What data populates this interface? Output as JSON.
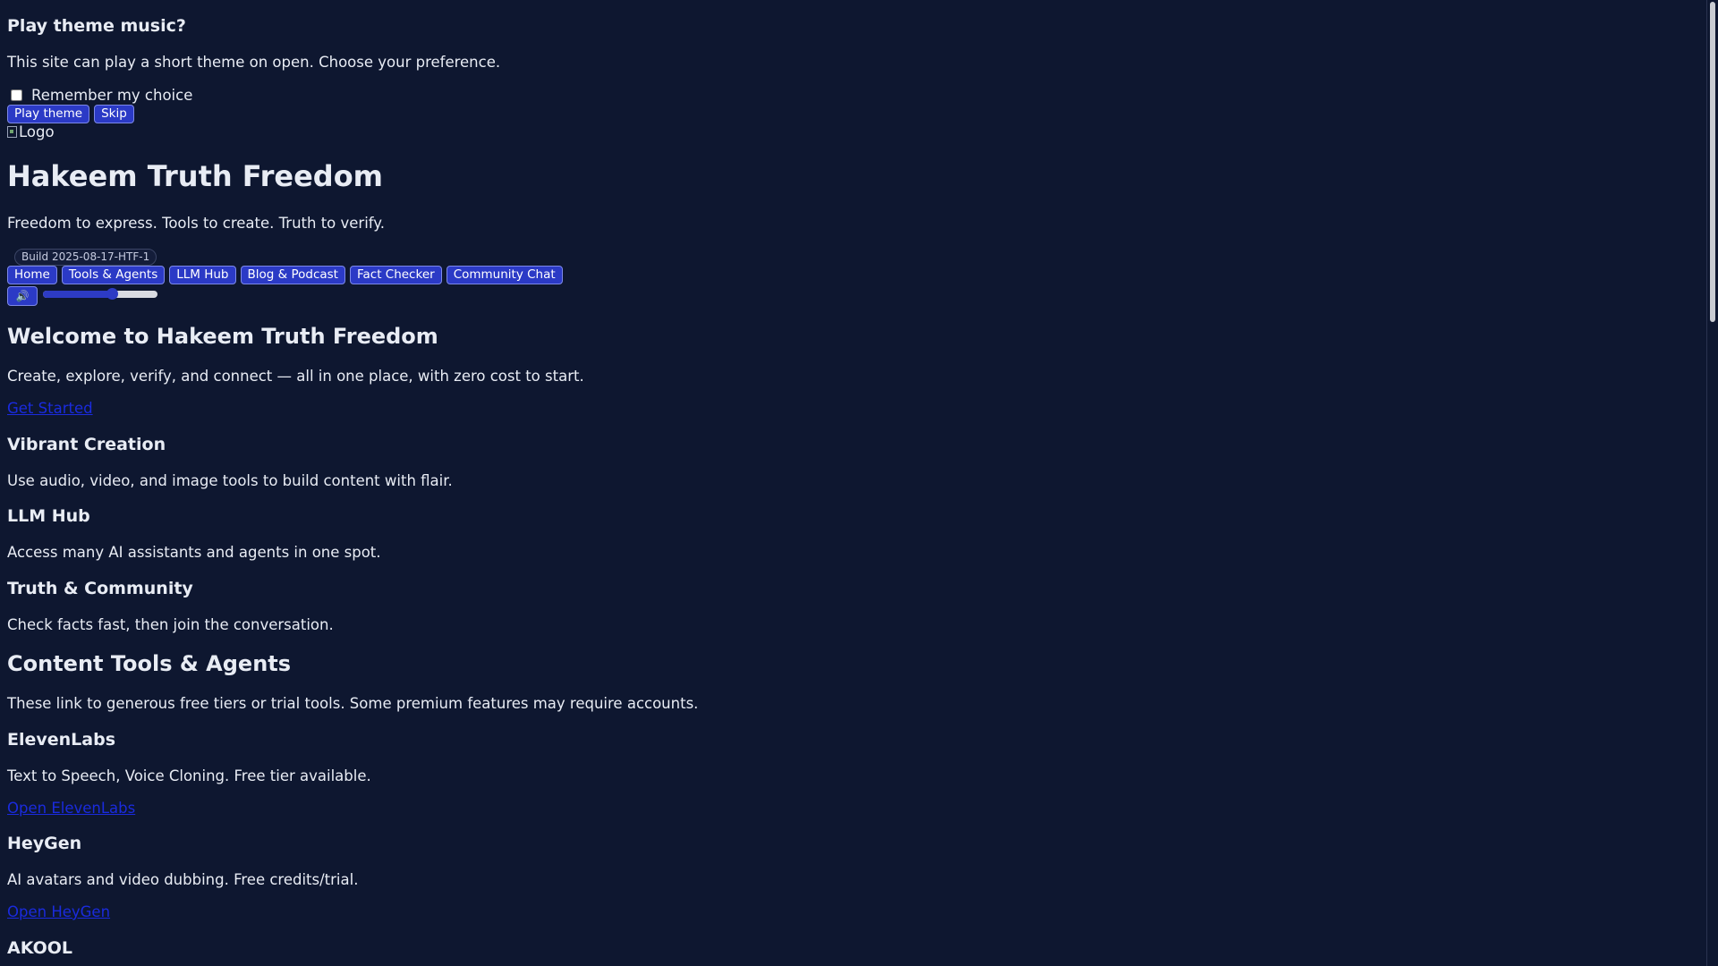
{
  "consent": {
    "title": "Play theme music?",
    "text": "This site can play a short theme on open. Choose your preference.",
    "remember_label": "Remember my choice",
    "play_label": "Play theme",
    "skip_label": "Skip"
  },
  "header": {
    "logo_alt": "Logo",
    "title": "Hakeem Truth Freedom",
    "tagline": "Freedom to express. Tools to create. Truth to verify.",
    "build": "Build 2025-08-17-HTF-1"
  },
  "nav": {
    "items": [
      {
        "label": "Home"
      },
      {
        "label": "Tools & Agents"
      },
      {
        "label": "LLM Hub"
      },
      {
        "label": "Blog & Podcast"
      },
      {
        "label": "Fact Checker"
      },
      {
        "label": "Community Chat"
      }
    ]
  },
  "audio": {
    "sound_icon": "🔊",
    "volume": 0.6
  },
  "welcome": {
    "title": "Welcome to Hakeem Truth Freedom",
    "text": "Create, explore, verify, and connect — all in one place, with zero cost to start.",
    "cta": "Get Started"
  },
  "features": [
    {
      "title": "Vibrant Creation",
      "text": "Use audio, video, and image tools to build content with flair."
    },
    {
      "title": "LLM Hub",
      "text": "Access many AI assistants and agents in one spot."
    },
    {
      "title": "Truth & Community",
      "text": "Check facts fast, then join the conversation."
    }
  ],
  "tools": {
    "title": "Content Tools & Agents",
    "intro": "These link to generous free tiers or trial tools. Some premium features may require accounts.",
    "items": [
      {
        "name": "ElevenLabs",
        "desc": "Text to Speech, Voice Cloning. Free tier available.",
        "link": "Open ElevenLabs"
      },
      {
        "name": "HeyGen",
        "desc": "AI avatars and video dubbing. Free credits/trial.",
        "link": "Open HeyGen"
      },
      {
        "name": "AKOOL"
      }
    ]
  },
  "colors": {
    "background": "#0e1730",
    "button": "#2b3ac6",
    "link": "#1a2bde"
  }
}
